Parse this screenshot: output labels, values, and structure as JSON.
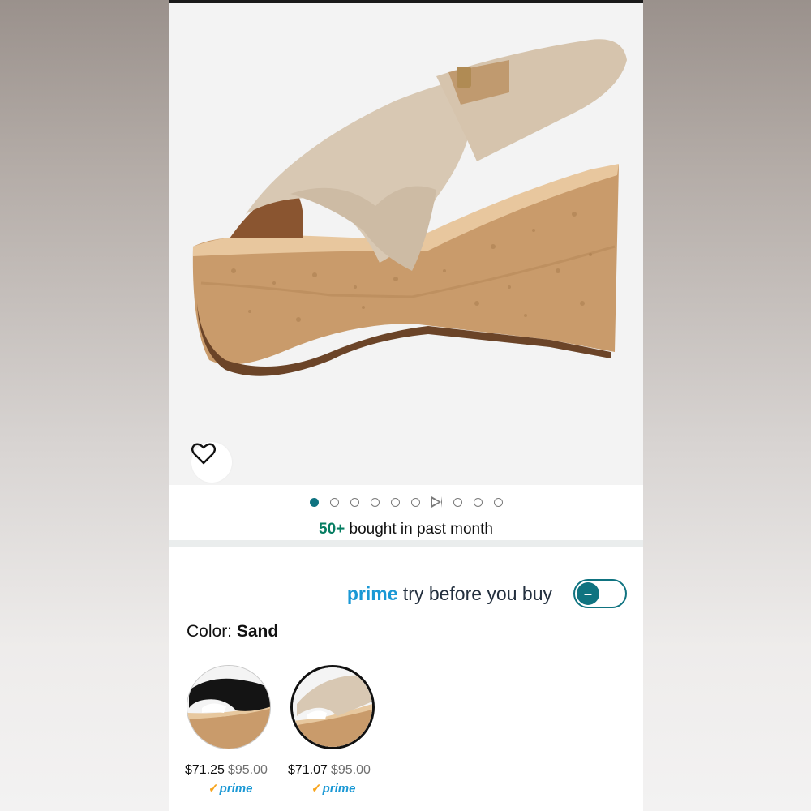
{
  "product": {
    "image_alt": "Sand leather crisscross wedge sandal with cork sole",
    "wishlist_icon": "heart-icon",
    "gallery": {
      "total_dots": 10,
      "active_index": 0,
      "video_index": 6
    },
    "bought_count": "50+",
    "bought_text": " bought in past month"
  },
  "prime": {
    "brand_word": "prime",
    "label": " try before you buy",
    "toggle_symbol": "–",
    "accent_color": "#0f7380"
  },
  "color": {
    "label": "Color: ",
    "value": "Sand"
  },
  "swatches": [
    {
      "name": "Black",
      "price": "$71.25",
      "list_price": "$95.00",
      "badge_check": "✓",
      "badge": "prime",
      "selected": false
    },
    {
      "name": "Sand",
      "price": "$71.07",
      "list_price": "$95.00",
      "badge_check": "✓",
      "badge": "prime",
      "selected": true
    }
  ]
}
